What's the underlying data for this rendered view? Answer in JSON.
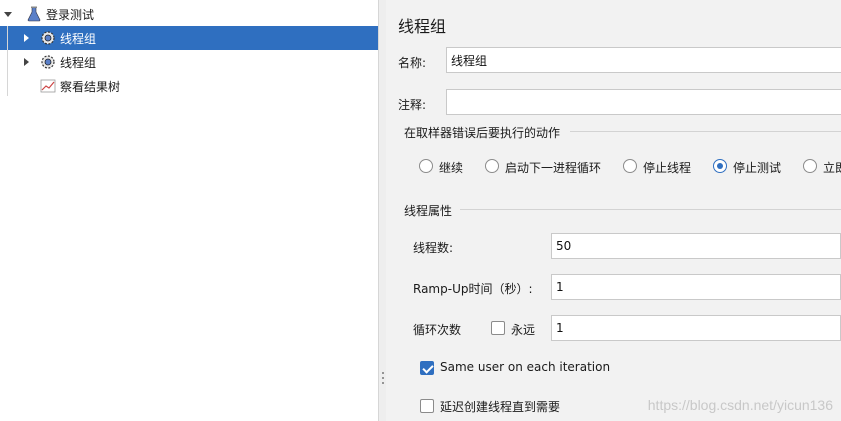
{
  "tree": {
    "items": [
      {
        "label": "登录测试",
        "icon": "flask-icon"
      },
      {
        "label": "线程组",
        "icon": "gear-icon"
      },
      {
        "label": "线程组",
        "icon": "gear-icon"
      },
      {
        "label": "察看结果树",
        "icon": "chart-icon"
      }
    ],
    "selected_index": 1
  },
  "panel": {
    "title": "线程组",
    "name_label": "名称:",
    "name_value": "线程组",
    "comment_label": "注释:",
    "comment_value": "",
    "error_action_group": "在取样器错误后要执行的动作",
    "error_actions": [
      "继续",
      "启动下一进程循环",
      "停止线程",
      "停止测试",
      "立即"
    ],
    "error_action_selected": "停止测试",
    "thread_props_group": "线程属性",
    "threads_label": "线程数:",
    "threads_value": "50",
    "rampup_label": "Ramp-Up时间（秒）:",
    "rampup_value": "1",
    "loop_label": "循环次数",
    "forever_label": "永远",
    "forever_checked": false,
    "loop_value": "1",
    "same_user_label": "Same user on each iteration",
    "same_user_checked": true,
    "delay_label": "延迟创建线程直到需要",
    "delay_checked": false
  },
  "watermark": "https://blog.csdn.net/yicun136",
  "colors": {
    "selection": "#2f6fc0",
    "panel_bg": "#f2f2f2"
  }
}
